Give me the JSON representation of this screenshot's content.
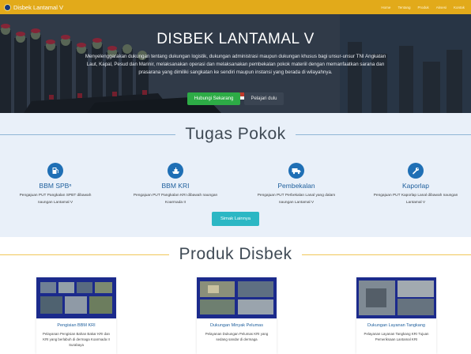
{
  "navbar": {
    "brand": "Disbek Lantamal V",
    "links": [
      "Home",
      "Tentang",
      "Produk",
      "Aksesi",
      "Kontak"
    ]
  },
  "hero": {
    "title": "DISBEK LANTAMAL V",
    "description": "Menyelenggarakan dukungan tentang dukungan logistik, dukungan administrasi maupun dukungan khusus bagi unsur-unsur TNI Angkatan Laut, Kapal, Pesud dan Marinir, melaksanakan operasi dan melaksanakan pembekalan pokok materiil dengan memanfaatkan sarana dan prasarana yang dimiliki sangkatan ke sendiri maupun instansi yang berada di wilayahnya.",
    "primary_button": "Hubungi Sekarang",
    "secondary_button": "Pelajari dulu"
  },
  "tugas": {
    "title": "Tugas Pokok",
    "items": [
      {
        "title": "BBM SPBⁿ",
        "desc": "Pengajuan PUT Pangkalan SPBT dibawah naungan Lantamal V",
        "icon": "fuel-pump-icon"
      },
      {
        "title": "BBM KRI",
        "desc": "Pengajuan PUT Pangkalan KRI dibawah naungan Koarmada II",
        "icon": "ship-icon"
      },
      {
        "title": "Pembekalan",
        "desc": "Pengajuan PUT Perbekalan Lanal yang dalam naungan Lantamal V",
        "icon": "truck-icon"
      },
      {
        "title": "Kaporlap",
        "desc": "Pengajuan PUT Kaporlap Lanal dibawah naungan Lantamal V",
        "icon": "wrench-icon"
      }
    ],
    "more_button": "Simak Lainnya"
  },
  "produk": {
    "title": "Produk Disbek",
    "cards": [
      {
        "title": "Pengisian BBM KRI",
        "desc": "Pelayanan Pengisian Bahan Bakar KRI dan KRI yang berlabuh di dermaga Koarmada II Surabaya"
      },
      {
        "title": "Dukungan Minyak Pelumas",
        "desc": "Pelayanan Dukungan Pelumas KRI yang sedang sandar di dermaga"
      },
      {
        "title": "Dukungan Layanan Tangkang",
        "desc": "Pelayanan Layanan Tangkang KRI Tujuan Pemeriksaan Lantamal KRI"
      }
    ]
  },
  "colors": {
    "navbar": "#e2aa1a",
    "primary_blue": "#1f6fb5",
    "green_button": "#2dab46",
    "teal_button": "#2cb7c4",
    "tugas_bg": "#e9f0f9"
  }
}
